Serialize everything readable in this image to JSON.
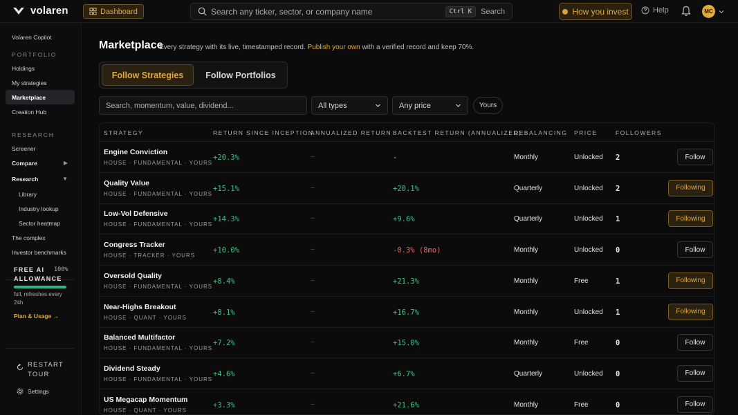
{
  "app": {
    "name": "volaren",
    "dashboard_label": "Dashboard",
    "search_placeholder": "Search any ticker, sector, or company name",
    "search_shortcut": "Ctrl K",
    "search_label": "Search",
    "invest_label": "How you invest",
    "help_label": "Help",
    "avatar_initials": "MC"
  },
  "sidebar": {
    "copilot": "Volaren Copilot",
    "portfolio_heading": "PORTFOLIO",
    "holdings": "Holdings",
    "my_strategies": "My strategies",
    "marketplace": "Marketplace",
    "creation_hub": "Creation Hub",
    "research_heading": "RESEARCH",
    "screener": "Screener",
    "compare": "Compare",
    "research": "Research",
    "library": "Library",
    "industry_lookup": "Industry lookup",
    "sector_heatmap": "Sector heatmap",
    "the_complex": "The complex",
    "investor_benchmarks": "Investor benchmarks",
    "allowance_title": "FREE AI ALLOWANCE",
    "allowance_pct": "100%",
    "allowance_fraction": 1.0,
    "allowance_note": "full, refreshes every 24h",
    "plan_link": "Plan & Usage →",
    "restart_tour": "RESTART TOUR",
    "settings": "Settings"
  },
  "main": {
    "title": "Marketplace",
    "subtitle_pre": "Every strategy with its live, timestamped record.",
    "subtitle_link": "Publish your own",
    "subtitle_post": "with a verified record and keep 70%.",
    "tabs": [
      {
        "label": "Follow Strategies",
        "active": true
      },
      {
        "label": "Follow Portfolios",
        "active": false
      }
    ],
    "filter_placeholder": "Search, momentum, value, dividend...",
    "type_select": "All types",
    "price_select": "Any price",
    "yours_chip": "Yours"
  },
  "table": {
    "headers": [
      "STRATEGY",
      "RETURN SINCE INCEPTION",
      "ANNUALIZED RETURN",
      "BACKTEST RETURN (ANNUALIZED)",
      "REBALANCING",
      "PRICE",
      "FOLLOWERS"
    ],
    "rows": [
      {
        "name": "Engine Conviction",
        "tags": "HOUSE · FUNDAMENTAL · YOURS",
        "return": "+20.3%",
        "annualized": "–",
        "backtest": "-",
        "bt_kind": "none",
        "rebalancing": "Monthly",
        "price": "Unlocked",
        "followers": "2",
        "action": "Follow",
        "following": false
      },
      {
        "name": "Quality Value",
        "tags": "HOUSE · FUNDAMENTAL · YOURS",
        "return": "+15.1%",
        "annualized": "–",
        "backtest": "+20.1%",
        "bt_kind": "pos",
        "rebalancing": "Quarterly",
        "price": "Unlocked",
        "followers": "2",
        "action": "Following",
        "following": true
      },
      {
        "name": "Low-Vol Defensive",
        "tags": "HOUSE · FUNDAMENTAL · YOURS",
        "return": "+14.3%",
        "annualized": "–",
        "backtest": "+9.6%",
        "bt_kind": "pos",
        "rebalancing": "Quarterly",
        "price": "Unlocked",
        "followers": "1",
        "action": "Following",
        "following": true
      },
      {
        "name": "Congress Tracker",
        "tags": "HOUSE · TRACKER · YOURS",
        "return": "+10.0%",
        "annualized": "–",
        "backtest": "-0.3% (8mo)",
        "bt_kind": "neg",
        "rebalancing": "Monthly",
        "price": "Unlocked",
        "followers": "0",
        "action": "Follow",
        "following": false
      },
      {
        "name": "Oversold Quality",
        "tags": "HOUSE · FUNDAMENTAL · YOURS",
        "return": "+8.4%",
        "annualized": "–",
        "backtest": "+21.3%",
        "bt_kind": "pos",
        "rebalancing": "Monthly",
        "price": "Free",
        "followers": "1",
        "action": "Following",
        "following": true
      },
      {
        "name": "Near-Highs Breakout",
        "tags": "HOUSE · QUANT · YOURS",
        "return": "+8.1%",
        "annualized": "–",
        "backtest": "+16.7%",
        "bt_kind": "pos",
        "rebalancing": "Monthly",
        "price": "Unlocked",
        "followers": "1",
        "action": "Following",
        "following": true
      },
      {
        "name": "Balanced Multifactor",
        "tags": "HOUSE · FUNDAMENTAL · YOURS",
        "return": "+7.2%",
        "annualized": "–",
        "backtest": "+15.0%",
        "bt_kind": "pos",
        "rebalancing": "Monthly",
        "price": "Free",
        "followers": "0",
        "action": "Follow",
        "following": false
      },
      {
        "name": "Dividend Steady",
        "tags": "HOUSE · FUNDAMENTAL · YOURS",
        "return": "+4.6%",
        "annualized": "–",
        "backtest": "+6.7%",
        "bt_kind": "pos",
        "rebalancing": "Quarterly",
        "price": "Unlocked",
        "followers": "0",
        "action": "Follow",
        "following": false
      },
      {
        "name": "US Megacap Momentum",
        "tags": "HOUSE · QUANT · YOURS",
        "return": "+3.3%",
        "annualized": "–",
        "backtest": "+21.6%",
        "bt_kind": "pos",
        "rebalancing": "Monthly",
        "price": "Free",
        "followers": "0",
        "action": "Follow",
        "following": false
      }
    ]
  },
  "colors": {
    "accent": "#e2a93b",
    "positive": "#3fbf8a",
    "negative": "#e06262",
    "background": "#0b0b0b"
  },
  "icons": {
    "logo": "volaren-logo-icon",
    "dashboard": "grid-icon",
    "search": "search-icon",
    "help": "help-circle-icon",
    "notifications": "bell-icon",
    "avatar_menu": "chevron-down-icon"
  }
}
